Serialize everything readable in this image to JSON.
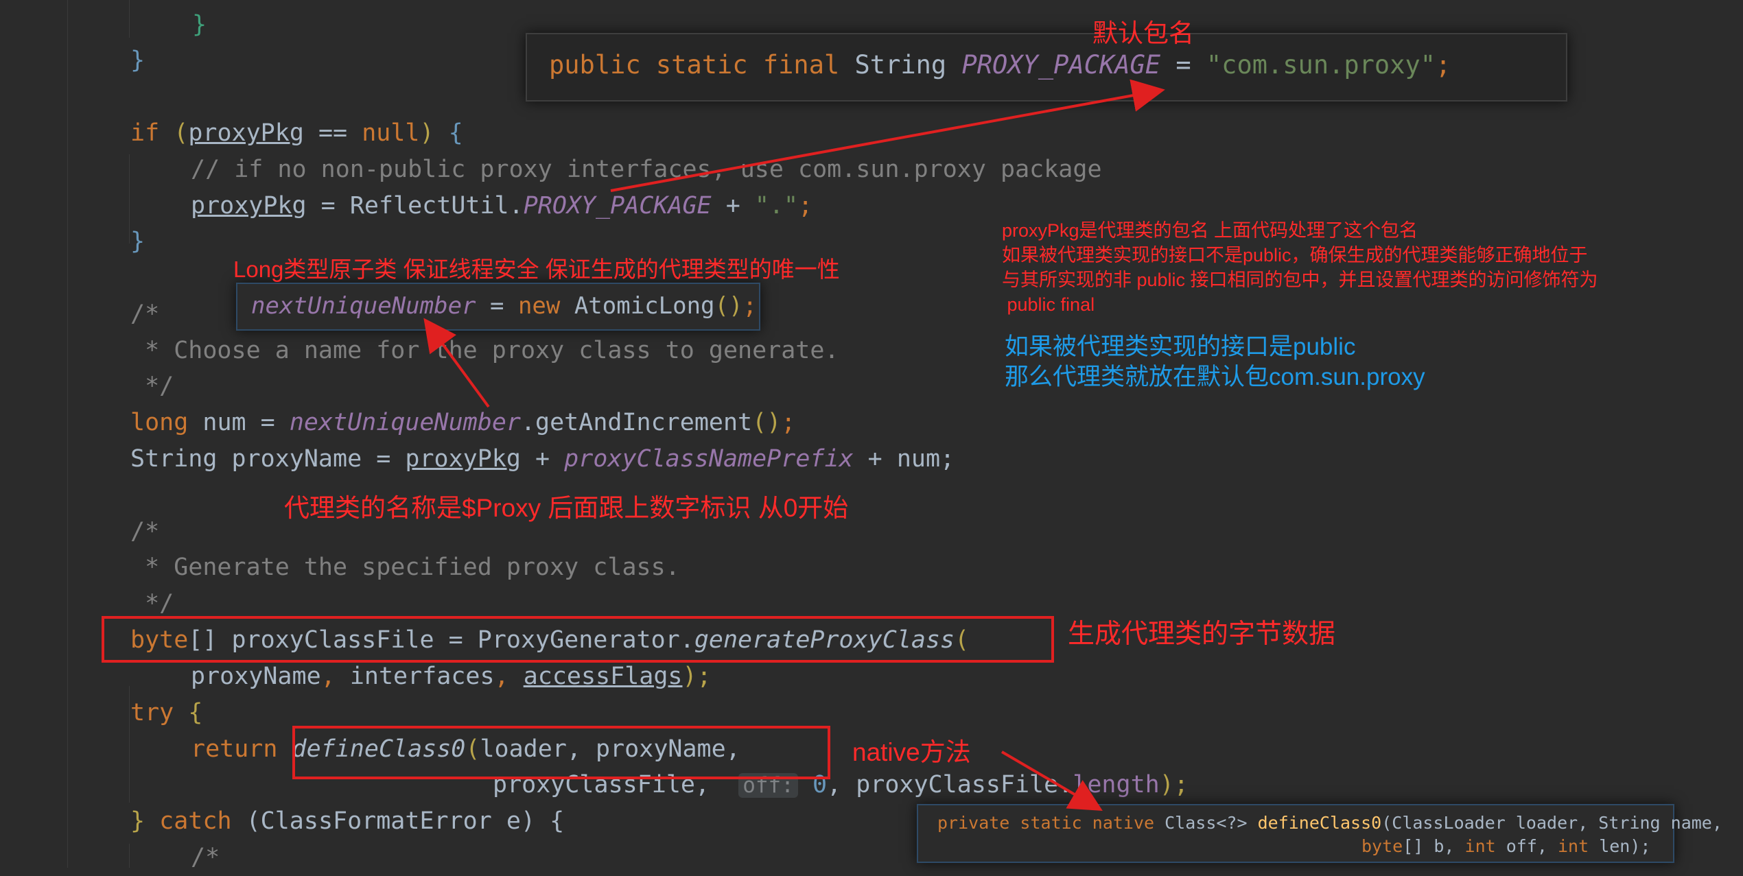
{
  "code": {
    "close_brace_1": "}",
    "close_brace_2": "}",
    "if_line": {
      "kw_if": "if",
      "var": "proxyPkg",
      "op": "==",
      "null": "null",
      "open": "{"
    },
    "comment_1": "// if no non-public proxy interfaces, use com.sun.proxy package",
    "assign_line": {
      "var": "proxyPkg",
      "eq": "=",
      "cls": "ReflectUtil.",
      "field": "PROXY_PACKAGE",
      "plus": "+",
      "str": "\".\"",
      "semi": ";"
    },
    "close_brace_3": "}",
    "comment_2a": "/*",
    "comment_2b": " * Choose a name for the proxy class to generate.",
    "comment_2c": " */",
    "long_line": {
      "kw": "long",
      "rest": " num = ",
      "field": "nextUniqueNumber",
      "call": ".getAndIncrement",
      "parens": "()",
      "semi": ";"
    },
    "string_line": {
      "type": "String proxyName = ",
      "var": "proxyPkg",
      "plus": " + ",
      "field": "proxyClassNamePrefix",
      "rest": " + num;"
    },
    "comment_3a": "/*",
    "comment_3b": " * Generate the specified proxy class.",
    "comment_3c": " */",
    "byte_line": {
      "kw": "byte",
      "bracket": "[]",
      "rest": " proxyClassFile = ProxyGenerator.",
      "method": "generateProxyClass",
      "paren": "("
    },
    "args_line": {
      "a": "proxyName",
      "c1": ", ",
      "b": "interfaces",
      "c2": ", ",
      "c": "accessFlags",
      "end": ");"
    },
    "try_line": {
      "kw": "try",
      "brace": " {"
    },
    "return_line": {
      "kw": "return ",
      "method": "defineClass0",
      "paren": "(",
      "args": "loader, proxyName,"
    },
    "return_line2": {
      "a": "proxyClassFile, ",
      "hint": "off:",
      "zero": " 0",
      "rest": ", proxyClassFile.",
      "len": "length",
      "end": ");"
    },
    "catch_line": {
      "brace": "} ",
      "kw": "catch",
      "rest": " (ClassFormatError e) {"
    },
    "comment_4": "/*"
  },
  "popup_package": {
    "kw": "public static final",
    "type": " String ",
    "field": "PROXY_PACKAGE",
    "eq": " = ",
    "str": "\"com.sun.proxy\"",
    "semi": ";"
  },
  "popup_atomic": {
    "field": "nextUniqueNumber",
    "eq": " = ",
    "kw": "new",
    "cls": " AtomicLong",
    "parens": "()",
    "semi": ";"
  },
  "popup_native": {
    "line1_kw": "private static native",
    "line1_rest": " Class<?> ",
    "line1_method": "defineClass0",
    "line1_args": "(ClassLoader loader, String name,",
    "line2_kw1": "byte",
    "line2_a": "[] b, ",
    "line2_kw2": "int",
    "line2_b": " off, ",
    "line2_kw3": "int",
    "line2_c": " len);"
  },
  "annotations": {
    "default_pkg": "默认包名",
    "long_atomic": "Long类型原子类 保证线程安全 保证生成的代理类型的唯一性",
    "proxy_pkg_note": "proxyPkg是代理类的包名 上面代码处理了这个包名\n如果被代理类实现的接口不是public，确保生成的代理类能够正确地位于\n与其所实现的非 public 接口相同的包中，并且设置代理类的访问修饰符为\n public final",
    "public_note": "如果被代理类实现的接口是public\n那么代理类就放在默认包com.sun.proxy",
    "proxy_name_note": "代理类的名称是$Proxy 后面跟上数字标识 从0开始",
    "bytecode_note": "生成代理类的字节数据",
    "native_note": "native方法"
  },
  "colors": {
    "background": "#2b2b2b",
    "keyword": "#cc7832",
    "string": "#6a8759",
    "comment": "#808080",
    "field": "#9876aa",
    "annotation_red": "#ff2a2a",
    "annotation_blue": "#1e9be8"
  }
}
